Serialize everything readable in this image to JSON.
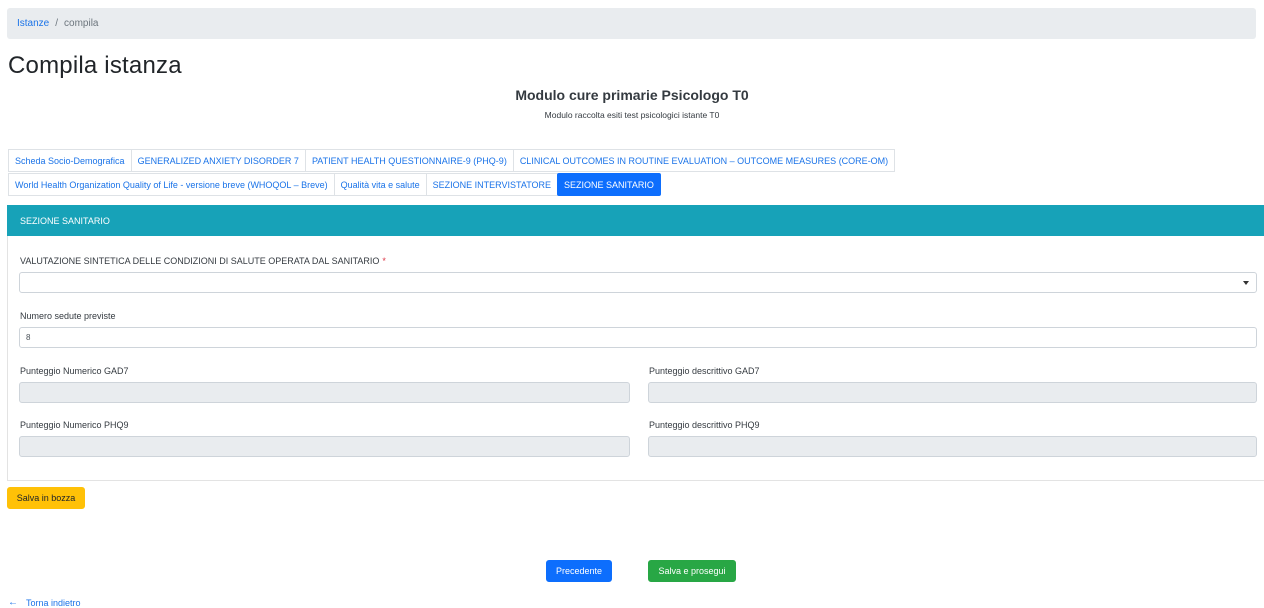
{
  "breadcrumb": {
    "link": "Istanze",
    "separator": "/",
    "current": "compila"
  },
  "page_title": "Compila istanza",
  "module": {
    "title": "Modulo cure primarie Psicologo T0",
    "subtitle": "Modulo raccolta esiti test psicologici istante T0"
  },
  "tabs_row1": [
    "Scheda Socio-Demografica",
    "GENERALIZED ANXIETY DISORDER 7",
    "PATIENT HEALTH QUESTIONNAIRE-9 (PHQ-9)",
    "CLINICAL OUTCOMES IN ROUTINE EVALUATION – OUTCOME MEASURES (CORE-OM)"
  ],
  "tabs_row2": [
    "World Health Organization Quality of Life - versione breve (WHOQOL – Breve)",
    "Qualità vita e salute",
    "SEZIONE INTERVISTATORE",
    "SEZIONE SANITARIO"
  ],
  "active_tab": "SEZIONE SANITARIO",
  "section": {
    "header": "SEZIONE SANITARIO",
    "valutazione_label": "VALUTAZIONE SINTETICA DELLE CONDIZIONI DI SALUTE OPERATA DAL SANITARIO",
    "required_mark": "*",
    "valutazione_value": "",
    "sedute_label": "Numero sedute previste",
    "sedute_value": "8",
    "gad7_num_label": "Punteggio Numerico GAD7",
    "gad7_desc_label": "Punteggio descrittivo GAD7",
    "phq9_num_label": "Punteggio Numerico PHQ9",
    "phq9_desc_label": "Punteggio descrittivo PHQ9"
  },
  "buttons": {
    "draft": "Salva in bozza",
    "previous": "Precedente",
    "save_next": "Salva e prosegui"
  },
  "back_link": {
    "arrow": "←",
    "label": "Torna indietro"
  },
  "colors": {
    "primary": "#0d6efd",
    "info": "#17a2b8",
    "warning": "#ffc107",
    "success": "#28a745"
  }
}
